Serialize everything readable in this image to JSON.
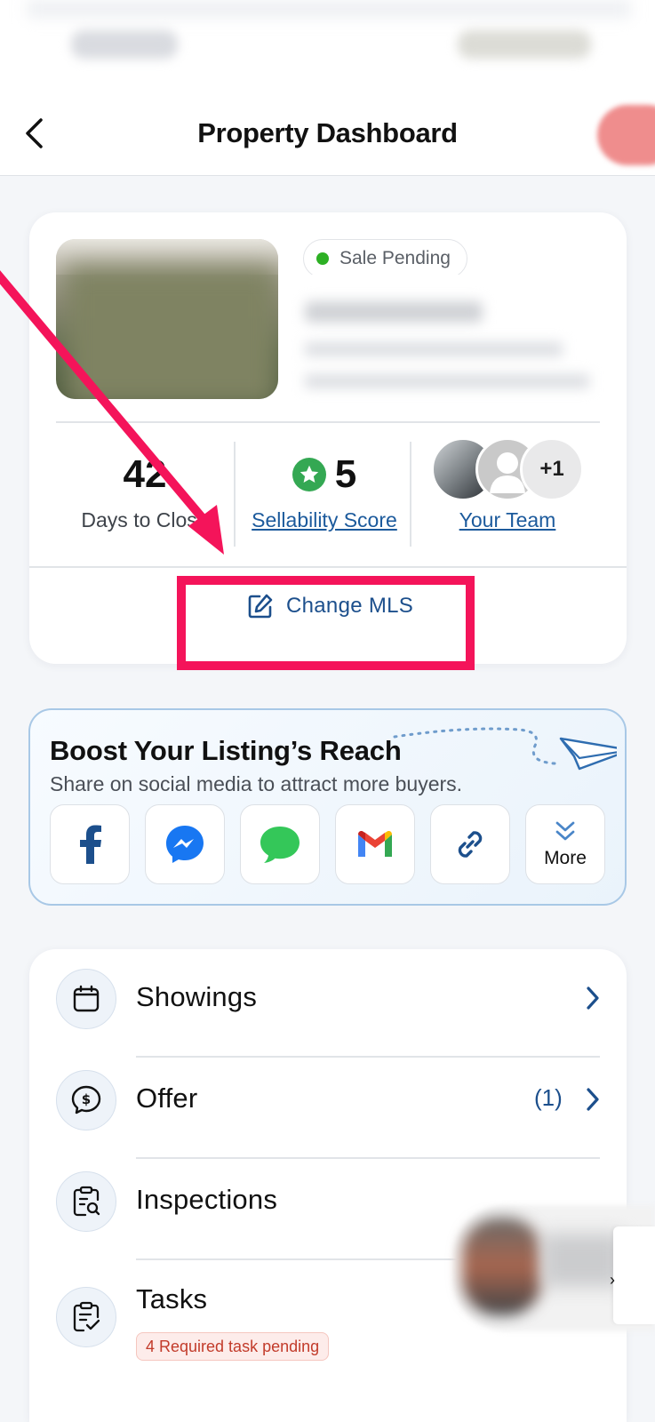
{
  "header": {
    "title": "Property Dashboard"
  },
  "property": {
    "status": "Sale Pending",
    "status_color": "#2db024"
  },
  "stats": {
    "days_value": "42",
    "days_label": "Days to Close",
    "score_value": "5",
    "score_label": "Sellability Score",
    "team_extra": "+1",
    "team_label": "Your Team"
  },
  "change_mls_label": "Change MLS",
  "boost": {
    "title": "Boost Your Listing’s Reach",
    "subtitle": "Share on social media to attract more buyers.",
    "share_buttons": [
      {
        "icon": "facebook-icon"
      },
      {
        "icon": "messenger-icon"
      },
      {
        "icon": "messages-icon"
      },
      {
        "icon": "gmail-icon"
      },
      {
        "icon": "link-icon"
      },
      {
        "icon": "chevron-double-down-icon",
        "label": "More"
      }
    ]
  },
  "menu": {
    "items": [
      {
        "label": "Showings",
        "icon": "calendar-icon"
      },
      {
        "label": "Offer",
        "icon": "offer-dollar-icon",
        "count": "(1)"
      },
      {
        "label": "Inspections",
        "icon": "clipboard-search-icon"
      },
      {
        "label": "Tasks",
        "icon": "clipboard-check-icon",
        "badge": "4 Required task pending"
      }
    ]
  },
  "colors": {
    "accent": "#1c4f8c",
    "highlight": "#f4145a",
    "score_green": "#34a853"
  }
}
